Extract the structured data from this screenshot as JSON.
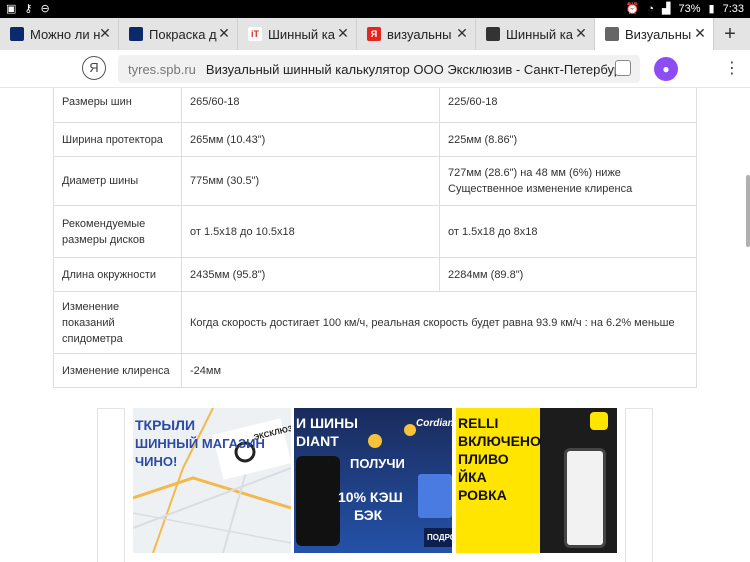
{
  "status_bar": {
    "battery": "73%",
    "time": "7:33"
  },
  "tabs": [
    {
      "label": "Можно ли на",
      "favicon_color": "#0b2a6b",
      "favicon_text": ""
    },
    {
      "label": "Покраска д",
      "favicon_color": "#0b2a6b",
      "favicon_text": ""
    },
    {
      "label": "Шинный ка",
      "favicon_color": "#ffffff",
      "favicon_text": "iT"
    },
    {
      "label": "визуальны",
      "favicon_color": "#e52620",
      "favicon_text": "Я"
    },
    {
      "label": "Шинный ка",
      "favicon_color": "#333333",
      "favicon_text": ""
    },
    {
      "label": "Визуальны",
      "favicon_color": "#666666",
      "favicon_text": ""
    }
  ],
  "address_bar": {
    "yandex_button": "Я",
    "host": "tyres.spb.ru",
    "title": "Визуальный шинный калькулятор ООО Эксклюзив - Санкт-Петербург"
  },
  "table": {
    "rows": [
      {
        "label": "Размеры шин",
        "a": "265/60-18",
        "b": "225/60-18"
      },
      {
        "label": "Ширина протектора",
        "a": "265мм (10.43\")",
        "b": "225мм (8.86\")"
      },
      {
        "label": "Диаметр шины",
        "a": "775мм (30.5\")",
        "b": "727мм (28.6\") на 48 мм (6%) ниже Существенное изменение клиренса"
      },
      {
        "label": "Рекомендуемые размеры дисков",
        "a": "от 1.5x18 до 10.5x18",
        "b": "от 1.5x18 до 8x18"
      },
      {
        "label": "Длина окружности",
        "a": "2435мм (95.8\")",
        "b": "2284мм (89.8\")"
      }
    ],
    "speedometer": {
      "label": "Изменение показаний спидометра",
      "value": "Когда скорость достигает 100 км/ч, реальная скорость будет равна 93.9 км/ч : на 6.2% меньше"
    },
    "clearance": {
      "label": "Изменение клиренса",
      "value": "-24мм"
    }
  },
  "ads": {
    "ad1": {
      "lines": [
        "ТКРЫЛИ",
        "ШИННЫЙ МАГАЗИН",
        "ЧИНО!"
      ],
      "brand": "ЭКСКЛЮЗИВ"
    },
    "ad2": {
      "lines": [
        "И ШИНЫ",
        "DIANT"
      ],
      "brand": "Cordiant",
      "promo1": "ПОЛУЧИ",
      "promo2": "10% КЭШ",
      "promo3": "БЭК",
      "more": "ПОДРОБ"
    },
    "ad3": {
      "lines": [
        "RELLI",
        "ВКЛЮЧЕНО",
        "ПЛИВО",
        "ЙКА",
        "РОВКА"
      ],
      "accent_color": "#ffe500"
    }
  }
}
